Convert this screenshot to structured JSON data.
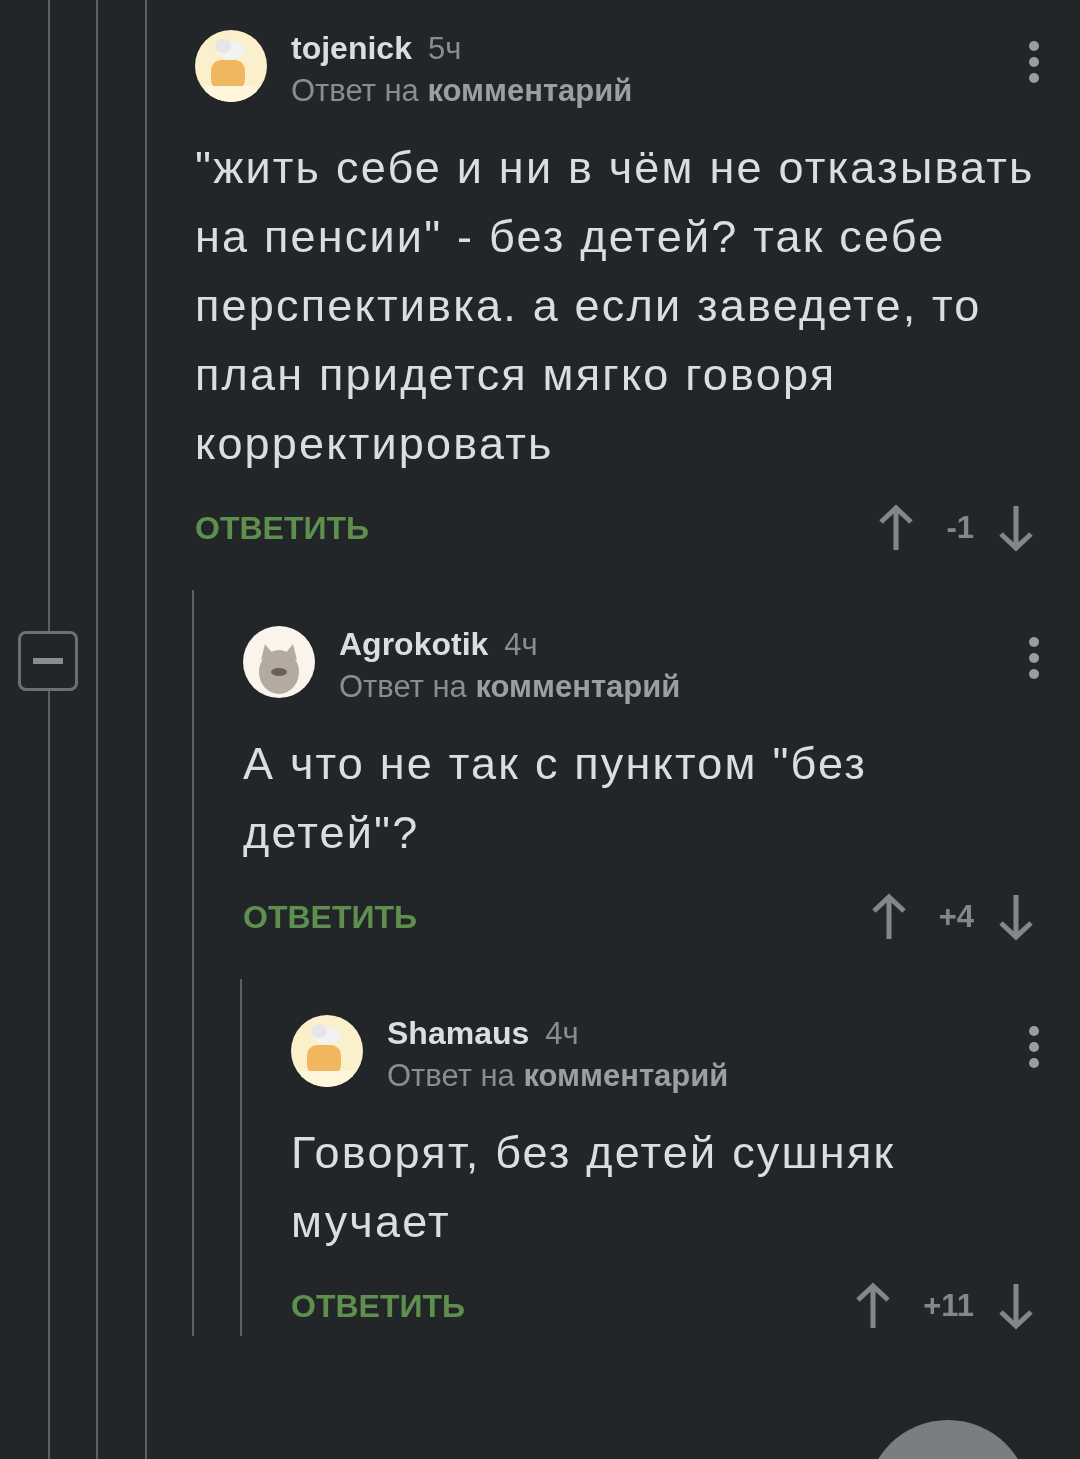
{
  "thread": {
    "expanded": true
  },
  "comments": [
    {
      "author": "tojenick",
      "time": "5ч",
      "reply_to": "Ответ на **комментарий**",
      "text": "\"жить себе и ни в чём не отказывать на пенсии\" - без детей? так себе перспективка. а если заведете, то план придется мягко говоря корректировать",
      "reply_label": "ОТВЕТИТЬ",
      "score": "-1",
      "children": [
        {
          "author": "Agrokotik",
          "time": "4ч",
          "reply_to": "Ответ на **комментарий**",
          "text": "А что не так с пунктом \"без детей\"?",
          "reply_label": "ОТВЕТИТЬ",
          "score": "+4",
          "children": [
            {
              "author": "Shamaus",
              "time": "4ч",
              "reply_to": "Ответ на **комментарий**",
              "text": "Говорят, без детей сушняк мучает",
              "reply_label": "ОТВЕТИТЬ",
              "score": "+11"
            }
          ]
        }
      ]
    }
  ]
}
